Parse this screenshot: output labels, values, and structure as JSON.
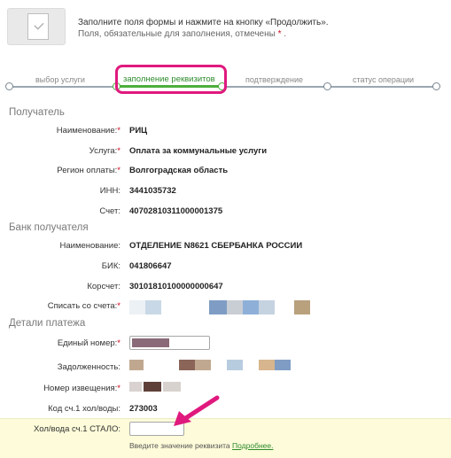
{
  "header": {
    "line1": "Заполните поля формы и нажмите на кнопку «Продолжить».",
    "line2": "Поля, обязательные для заполнения, отмечены",
    "line2_marker": "*",
    "line2_end": "."
  },
  "steps": [
    {
      "label": "выбор услуги"
    },
    {
      "label": "заполнение реквизитов"
    },
    {
      "label": "подтверждение"
    },
    {
      "label": "статус операции"
    }
  ],
  "recipient": {
    "title": "Получатель",
    "name_label": "Наименование:",
    "name_value": "РИЦ",
    "service_label": "Услуга:",
    "service_value": "Оплата за коммунальные услуги",
    "region_label": "Регион оплаты:",
    "region_value": "Волгоградская область",
    "inn_label": "ИНН:",
    "inn_value": "3441035732",
    "account_label": "Счет:",
    "account_value": "40702810311000001375"
  },
  "bank": {
    "title": "Банк получателя",
    "name_label": "Наименование:",
    "name_value": "ОТДЕЛЕНИЕ N8621 СБЕРБАНКА РОССИИ",
    "bik_label": "БИК:",
    "bik_value": "041806647",
    "corr_label": "Корсчет:",
    "corr_value": "30101810100000000647",
    "debit_label": "Списать со счета:"
  },
  "payment": {
    "title": "Детали платежа",
    "number_label": "Единый номер:",
    "debt_label": "Задолженность:",
    "notice_label": "Номер извещения:",
    "code_label": "Код сч.1 хол/воды:",
    "code_value": "273003",
    "meter_label": "Хол/вода сч.1 СТАЛО:",
    "meter_value": "",
    "hint_text": "Введите значение реквизита",
    "hint_link": "Подробнее."
  },
  "required_marker": "*"
}
